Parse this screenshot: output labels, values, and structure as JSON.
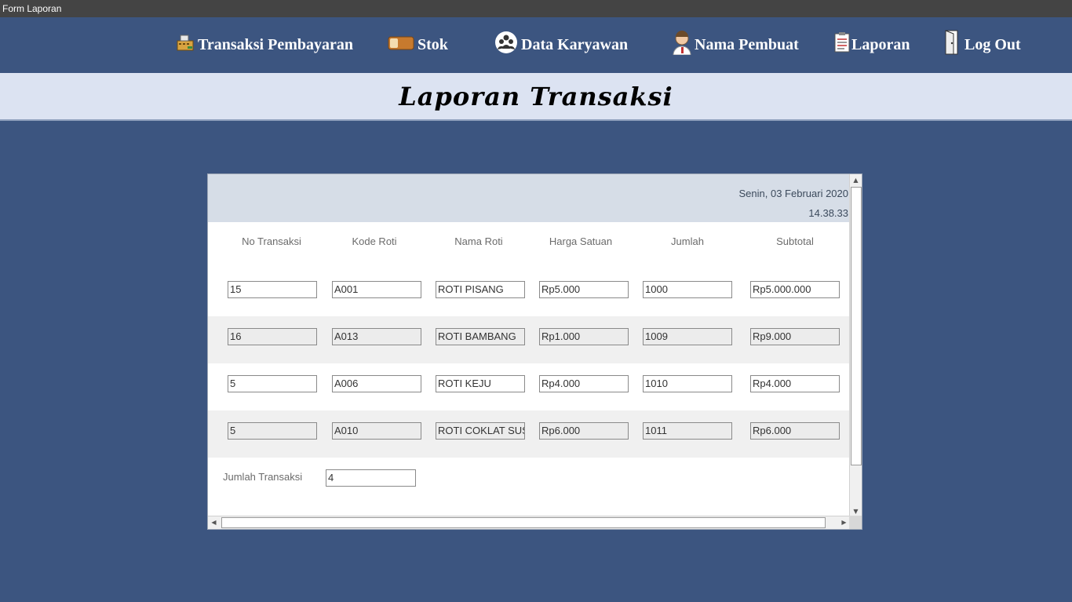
{
  "window": {
    "title": "Form Laporan"
  },
  "nav": {
    "items": [
      {
        "label": "Transaksi Pembayaran",
        "icon": "cash-register-icon"
      },
      {
        "label": "Stok",
        "icon": "bread-icon"
      },
      {
        "label": "Data Karyawan",
        "icon": "people-icon"
      },
      {
        "label": "Nama Pembuat",
        "icon": "person-icon"
      },
      {
        "label": "Laporan",
        "icon": "report-icon"
      },
      {
        "label": "Log Out",
        "icon": "door-icon"
      }
    ]
  },
  "header": {
    "title": "Laporan Transaksi"
  },
  "report": {
    "date": "Senin, 03 Februari 2020",
    "time": "14.38.33",
    "columns": [
      "No Transaksi",
      "Kode Roti",
      "Nama Roti",
      "Harga Satuan",
      "Jumlah",
      "Subtotal"
    ],
    "rows": [
      [
        "15",
        "A001",
        "ROTI PISANG",
        "Rp5.000",
        "1000",
        "Rp5.000.000"
      ],
      [
        "16",
        "A013",
        "ROTI BAMBANG",
        "Rp1.000",
        "1009",
        "Rp9.000"
      ],
      [
        "5",
        "A006",
        "ROTI KEJU",
        "Rp4.000",
        "1010",
        "Rp4.000"
      ],
      [
        "5",
        "A010",
        "ROTI COKLAT SUSU",
        "Rp6.000",
        "1011",
        "Rp6.000"
      ]
    ],
    "summary_label": "Jumlah Transaksi",
    "summary_value": "4"
  },
  "colors": {
    "background": "#3c5580",
    "header_band": "#dce3f2",
    "report_header": "#d6dde7"
  }
}
